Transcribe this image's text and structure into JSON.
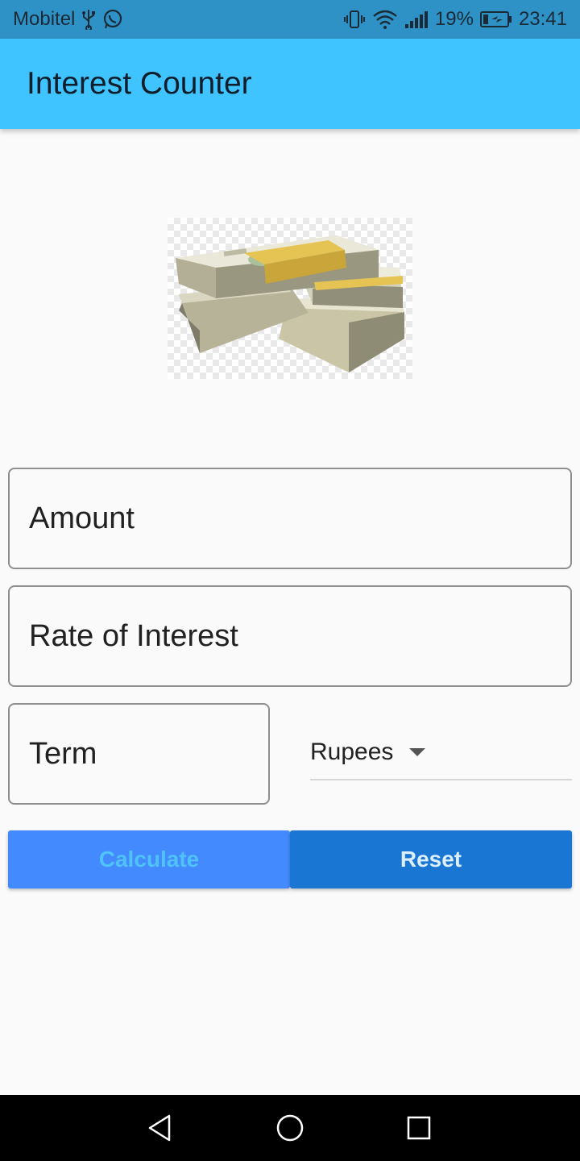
{
  "status_bar": {
    "carrier": "Mobitel",
    "battery": "19%",
    "time": "23:41"
  },
  "app_bar": {
    "title": "Interest Counter"
  },
  "form": {
    "amount_label": "Amount",
    "rate_label": "Rate of Interest",
    "term_label": "Term",
    "currency_selected": "Rupees"
  },
  "buttons": {
    "calculate_label": "Calculate",
    "reset_label": "Reset"
  },
  "icons": {
    "usb": "usb-icon",
    "whatsapp": "whatsapp-icon",
    "vibrate": "vibrate-icon",
    "wifi": "wifi-icon",
    "signal": "signal-icon",
    "battery": "battery-charging-icon",
    "back": "back-icon",
    "home": "home-icon",
    "recents": "recents-icon"
  },
  "colors": {
    "status_bar": "#2f92c6",
    "app_bar": "#40c4ff",
    "calculate_bg": "#448aff",
    "calculate_text": "#4fc3f7",
    "reset_bg": "#1976d2"
  }
}
